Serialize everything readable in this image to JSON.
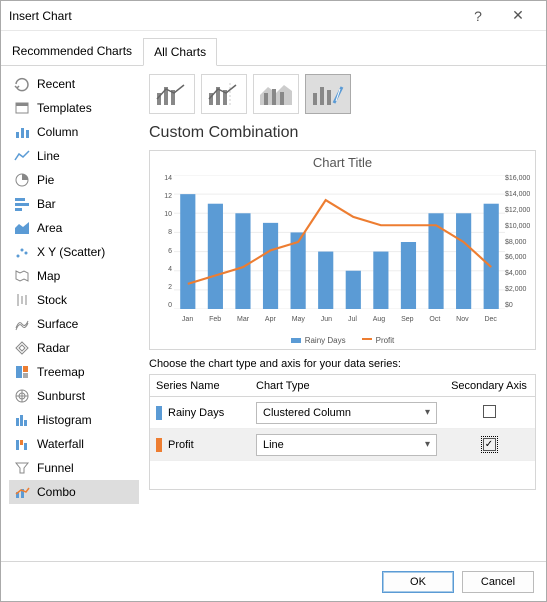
{
  "dialog": {
    "title": "Insert Chart"
  },
  "tabs": {
    "recommended": "Recommended Charts",
    "all": "All Charts"
  },
  "sidebar": {
    "items": [
      {
        "label": "Recent"
      },
      {
        "label": "Templates"
      },
      {
        "label": "Column"
      },
      {
        "label": "Line"
      },
      {
        "label": "Pie"
      },
      {
        "label": "Bar"
      },
      {
        "label": "Area"
      },
      {
        "label": "X Y (Scatter)"
      },
      {
        "label": "Map"
      },
      {
        "label": "Stock"
      },
      {
        "label": "Surface"
      },
      {
        "label": "Radar"
      },
      {
        "label": "Treemap"
      },
      {
        "label": "Sunburst"
      },
      {
        "label": "Histogram"
      },
      {
        "label": "Waterfall"
      },
      {
        "label": "Funnel"
      },
      {
        "label": "Combo"
      }
    ]
  },
  "main": {
    "variant_selected": 3,
    "section_title": "Custom Combination",
    "choose_label": "Choose the chart type and axis for your data series:",
    "grid_headers": {
      "name": "Series Name",
      "type": "Chart Type",
      "axis": "Secondary Axis"
    },
    "series": [
      {
        "name": "Rainy Days",
        "type": "Clustered Column",
        "secondary": false,
        "color": "#5b9bd5"
      },
      {
        "name": "Profit",
        "type": "Line",
        "secondary": true,
        "color": "#ed7d31"
      }
    ]
  },
  "footer": {
    "ok": "OK",
    "cancel": "Cancel"
  },
  "chart_data": {
    "type": "combo",
    "title": "Chart Title",
    "categories": [
      "Jan",
      "Feb",
      "Mar",
      "Apr",
      "May",
      "Jun",
      "Jul",
      "Aug",
      "Sep",
      "Oct",
      "Nov",
      "Dec"
    ],
    "y_left": {
      "min": 0,
      "max": 14,
      "ticks": [
        0,
        2,
        4,
        6,
        8,
        10,
        12,
        14
      ]
    },
    "y_right": {
      "min": 0,
      "max": 16000,
      "ticks": [
        "$0",
        "$2,000",
        "$4,000",
        "$6,000",
        "$8,000",
        "$10,000",
        "$12,000",
        "$14,000",
        "$16,000"
      ]
    },
    "series": [
      {
        "name": "Rainy Days",
        "type": "bar",
        "axis": "left",
        "color": "#5b9bd5",
        "values": [
          12,
          11,
          10,
          9,
          8,
          6,
          4,
          6,
          7,
          10,
          10,
          11
        ]
      },
      {
        "name": "Profit",
        "type": "line",
        "axis": "right",
        "color": "#ed7d31",
        "values": [
          3000,
          4000,
          5000,
          7000,
          8000,
          13000,
          11000,
          10000,
          10000,
          10000,
          8000,
          5000
        ]
      }
    ],
    "legend": [
      "Rainy Days",
      "Profit"
    ]
  }
}
